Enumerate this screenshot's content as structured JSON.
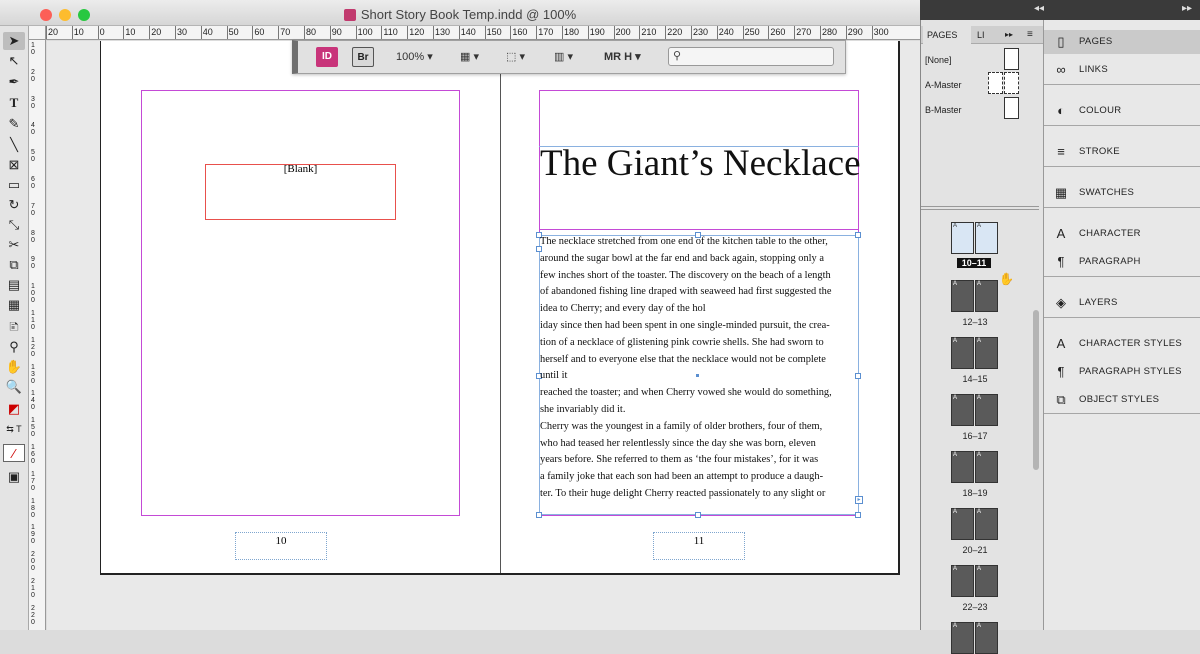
{
  "window": {
    "title": "Short Story Book Temp.indd @ 100%"
  },
  "ruler": {
    "top_labels": [
      "20",
      "10",
      "0",
      "10",
      "20",
      "30",
      "40",
      "50",
      "60",
      "70",
      "80",
      "90",
      "100",
      "110",
      "120",
      "130",
      "140",
      "150",
      "160",
      "170",
      "180",
      "190",
      "200",
      "210",
      "220",
      "230",
      "240",
      "250",
      "260",
      "270",
      "280",
      "290",
      "300"
    ],
    "left_labels": [
      "10",
      "20",
      "30",
      "40",
      "50",
      "60",
      "70",
      "80",
      "90",
      "100",
      "110",
      "120",
      "130",
      "140",
      "150",
      "160",
      "170",
      "180",
      "190",
      "200",
      "210",
      "220"
    ]
  },
  "control_bar": {
    "app_badge": "ID",
    "bridge_badge": "Br",
    "zoom": "100%",
    "workspace": "MR H"
  },
  "pages_panel": {
    "tab_pages": "PAGES",
    "tab_links": "LI",
    "masters": [
      "[None]",
      "A-Master",
      "B-Master"
    ],
    "spreads": [
      "10–11",
      "12–13",
      "14–15",
      "16–17",
      "18–19",
      "20–21",
      "22–23"
    ]
  },
  "right_panel": {
    "items": [
      {
        "label": "PAGES",
        "icon": "pages-icon"
      },
      {
        "label": "LINKS",
        "icon": "links-icon"
      },
      {
        "label": "COLOUR",
        "icon": "colour-icon"
      },
      {
        "label": "STROKE",
        "icon": "stroke-icon"
      },
      {
        "label": "SWATCHES",
        "icon": "swatches-icon"
      },
      {
        "label": "CHARACTER",
        "icon": "character-icon"
      },
      {
        "label": "PARAGRAPH",
        "icon": "paragraph-icon"
      },
      {
        "label": "LAYERS",
        "icon": "layers-icon"
      },
      {
        "label": "CHARACTER STYLES",
        "icon": "character-styles-icon"
      },
      {
        "label": "PARAGRAPH STYLES",
        "icon": "paragraph-styles-icon"
      },
      {
        "label": "OBJECT STYLES",
        "icon": "object-styles-icon"
      }
    ]
  },
  "document": {
    "left_page": {
      "placeholder": "[Blank]",
      "folio": "10"
    },
    "right_page": {
      "headline": "The Giant’s Necklace",
      "folio": "11",
      "body_lines": [
        "The necklace stretched from one end of the kitchen table to the other,",
        "around the sugar bowl at the far end and back again, stopping only a",
        "few inches short of the toaster. The discovery on the beach of a length",
        "of abandoned fishing line draped with seaweed had first suggested the",
        "idea to Cherry; and every day of the hol",
        "iday since then had been spent in one single-minded pursuit, the crea-",
        "tion of a necklace of glistening pink cowrie shells. She had sworn to",
        "herself and to everyone else that the necklace would not be complete",
        "until it",
        "reached the toaster; and when Cherry vowed she would do something,",
        "she invariably did it.",
        "Cherry was the youngest in a family of older brothers, four of them,",
        "who had teased her relentlessly since the day she was born, eleven",
        "years before. She referred to them as ‘the four mistakes’, for it was",
        "a family joke that each son had been an attempt to produce a daugh-",
        "ter. To their huge delight Cherry reacted passionately to any slight or"
      ]
    }
  },
  "colors": {
    "margin_guide": "#c44ad6",
    "frame_edge": "#8ab1e0",
    "placeholder_frame": "#e8504c",
    "indesign_badge": "#c8347a"
  }
}
